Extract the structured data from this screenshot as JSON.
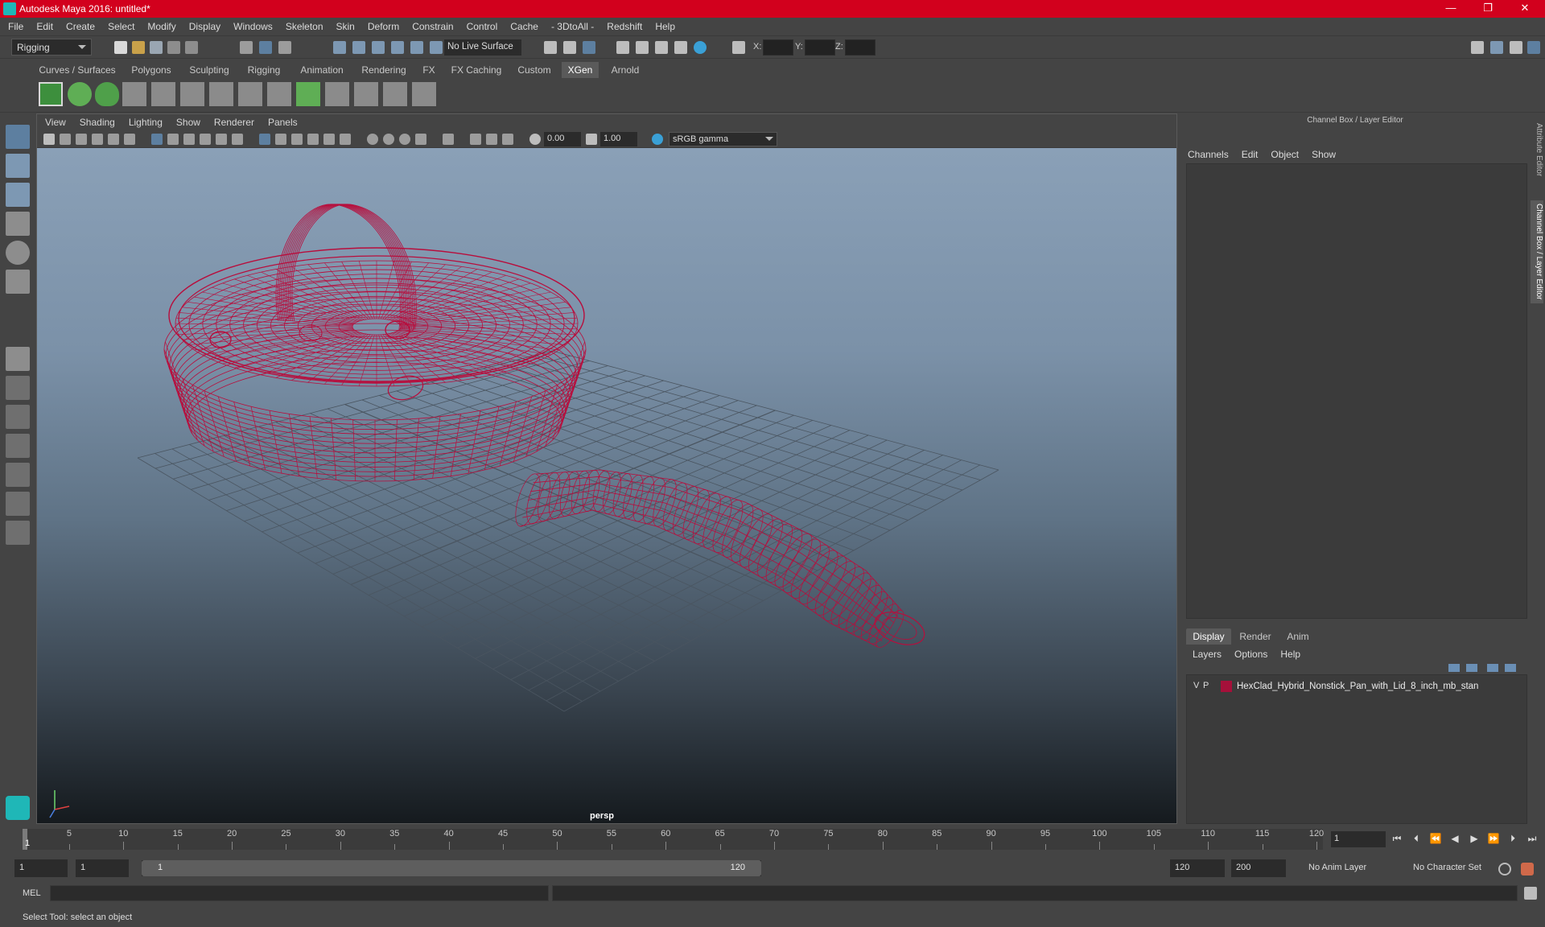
{
  "titlebar": {
    "title": "Autodesk Maya 2016: untitled*",
    "minimize": "—",
    "maximize": "❐",
    "close": "✕"
  },
  "menubar": [
    "File",
    "Edit",
    "Create",
    "Select",
    "Modify",
    "Display",
    "Windows",
    "Skeleton",
    "Skin",
    "Deform",
    "Constrain",
    "Control",
    "Cache",
    "- 3DtoAll -",
    "Redshift",
    "Help"
  ],
  "statusline": {
    "mode": "Rigging",
    "live_surface": "No Live Surface",
    "x_label": "X:",
    "y_label": "Y:",
    "z_label": "Z:"
  },
  "shelf_tabs": [
    "Curves / Surfaces",
    "Polygons",
    "Sculpting",
    "Rigging",
    "Animation",
    "Rendering",
    "FX",
    "FX Caching",
    "Custom",
    "XGen",
    "Arnold"
  ],
  "shelf_active": "XGen",
  "viewport": {
    "menu": [
      "View",
      "Shading",
      "Lighting",
      "Show",
      "Renderer",
      "Panels"
    ],
    "exposure": "0.00",
    "gamma": "1.00",
    "color_space": "sRGB gamma",
    "camera": "persp",
    "wire_color": "#b80d3c"
  },
  "channel_box": {
    "title": "Channel Box / Layer Editor",
    "menu": [
      "Channels",
      "Edit",
      "Object",
      "Show"
    ]
  },
  "layer_editor": {
    "tabs": [
      "Display",
      "Render",
      "Anim"
    ],
    "active_tab": "Display",
    "menu": [
      "Layers",
      "Options",
      "Help"
    ],
    "layers": [
      {
        "v": "V",
        "p": "P",
        "name": "HexClad_Hybrid_Nonstick_Pan_with_Lid_8_inch_mb_stan",
        "color": "#a5103a"
      }
    ]
  },
  "side_tabs": [
    "Attribute Editor",
    "Channel Box / Layer Editor"
  ],
  "time_slider": {
    "ticks": [
      1,
      5,
      10,
      15,
      20,
      25,
      30,
      35,
      40,
      45,
      50,
      55,
      60,
      65,
      70,
      75,
      80,
      85,
      90,
      95,
      100,
      105,
      110,
      115,
      120
    ],
    "labels": [
      "5",
      "10",
      "15",
      "20",
      "25",
      "30",
      "35",
      "40",
      "45",
      "50",
      "55",
      "60",
      "65",
      "70",
      "75",
      "80",
      "85",
      "90",
      "95",
      "100",
      "105",
      "110",
      "115",
      "120"
    ],
    "current_frame": "1",
    "current_frame_field": "1"
  },
  "range_slider": {
    "start": "1",
    "anim_start": "1",
    "range_start": "1",
    "range_end": "120",
    "anim_end": "120",
    "end": "200",
    "anim_layer": "No Anim Layer",
    "character_set": "No Character Set"
  },
  "command_line": {
    "label": "MEL"
  },
  "help_line": {
    "text": "Select Tool: select an object"
  }
}
